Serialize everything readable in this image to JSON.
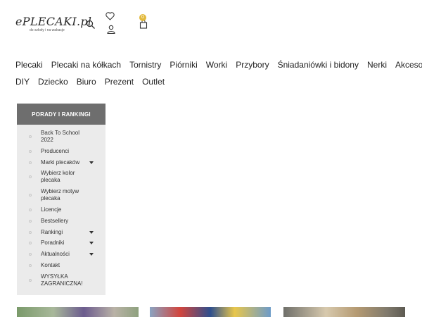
{
  "header": {
    "logo_text": "ePLECAKI.pl",
    "logo_tagline": "do szkoły i na wakacje",
    "cart_count": "0",
    "icons": [
      "search-icon",
      "heart-icon",
      "user-icon",
      "cart-icon"
    ]
  },
  "nav": {
    "row1": [
      "Plecaki",
      "Plecaki na kółkach",
      "Tornistry",
      "Piórniki",
      "Worki",
      "Przybory",
      "Śniadaniówki i bidony",
      "Nerki",
      "Akcesoria"
    ],
    "row2": [
      "DIY",
      "Dziecko",
      "Biuro",
      "Prezent",
      "Outlet"
    ]
  },
  "sidebar": {
    "title": "PORADY I RANKINGI",
    "items": [
      {
        "label": "Back To School 2022",
        "has_submenu": false
      },
      {
        "label": "Producenci",
        "has_submenu": false
      },
      {
        "label": "Marki plecaków",
        "has_submenu": true
      },
      {
        "label": "Wybierz kolor plecaka",
        "has_submenu": false
      },
      {
        "label": "Wybierz motyw plecaka",
        "has_submenu": false
      },
      {
        "label": "Licencje",
        "has_submenu": false
      },
      {
        "label": "Bestsellery",
        "has_submenu": false
      },
      {
        "label": "Rankingi",
        "has_submenu": true
      },
      {
        "label": "Poradniki",
        "has_submenu": true
      },
      {
        "label": "Aktualności",
        "has_submenu": true
      },
      {
        "label": "Kontakt",
        "has_submenu": false
      },
      {
        "label": "WYSYŁKA ZAGRANICZNA!",
        "has_submenu": false
      }
    ]
  },
  "colors": {
    "sidebar_header_bg": "#6e6e6e",
    "sidebar_bg": "#ebebeb",
    "cart_badge": "#e2b93b"
  }
}
